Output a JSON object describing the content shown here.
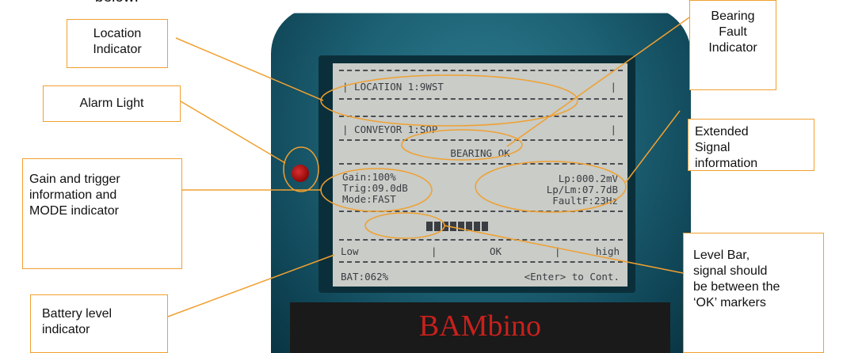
{
  "intro_fragment": "below:",
  "callouts": {
    "location": [
      "Location",
      "Indicator"
    ],
    "alarm": "Alarm Light",
    "gain": [
      "Gain and trigger",
      "information and",
      "MODE indicator"
    ],
    "battery": [
      "Battery level",
      "indicator"
    ],
    "bearing": [
      "Bearing",
      "Fault",
      "Indicator"
    ],
    "extended": [
      "Extended",
      "Signal",
      "information"
    ],
    "level": [
      "Level Bar,",
      "signal should",
      "be between the",
      "‘OK’ markers"
    ]
  },
  "screen": {
    "location": "| LOCATION 1:9WST",
    "location_end": "|",
    "conveyor": "| CONVEYOR 1:SOP",
    "conveyor_end": "|",
    "bearing_status": "BEARING OK",
    "gain": "Gain:100%",
    "trig": "Trig:09.0dB",
    "mode": "Mode:FAST",
    "lp": "Lp:000.2mV",
    "lp_lm": "Lp/Lm:07.7dB",
    "fault_f": "FaultF:23Hz",
    "scale_low": "Low",
    "scale_sep1": "|",
    "scale_ok": "OK",
    "scale_sep2": "|",
    "scale_high": "high",
    "battery": "BAT:062%",
    "continue": "<Enter> to Cont."
  },
  "level_bar_segments": 8,
  "brand": "BAMbino",
  "colors": {
    "callout_border": "#f0a030",
    "device_teal": "#1d6275",
    "lcd_bg": "#c9ccc7",
    "logo_red": "#c8211c"
  }
}
